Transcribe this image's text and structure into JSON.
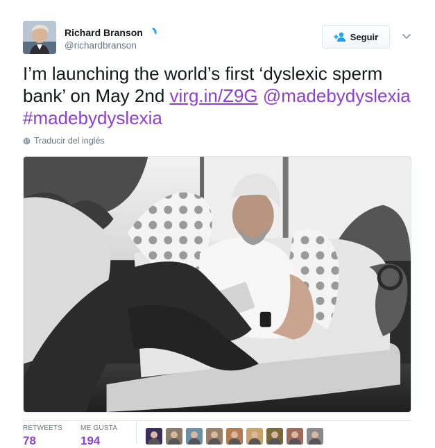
{
  "author": {
    "name": "Richard Branson",
    "handle": "@richardbranson",
    "verified": true
  },
  "follow_button": {
    "label": "Seguir",
    "icon": "person-add-icon"
  },
  "more_menu": {
    "icon": "chevron-down-icon"
  },
  "tweet": {
    "text_part1": "I’m launching the world’s first ‘dyslexic sperm bank’ on May 2nd ",
    "link": "virg.in/Z9G",
    "mention": "@madebydyslexia",
    "hashtag": "#madebydyslexia",
    "link_color": "#8c3fd6"
  },
  "translate": {
    "label": "Traducir del inglés",
    "icon": "globe-icon"
  },
  "stats": {
    "retweets_label": "RETWEETS",
    "retweets_value": "78",
    "likes_label": "ME GUSTA",
    "likes_value": "194"
  },
  "likers": [
    {
      "color": "#3a2e5c"
    },
    {
      "color": "#8a7a6a"
    },
    {
      "color": "#6c8fa8"
    },
    {
      "color": "#9b8067"
    },
    {
      "color": "#b47c4f"
    },
    {
      "color": "#c9a36a"
    },
    {
      "color": "#7a6a3a"
    },
    {
      "color": "#a06a5a"
    },
    {
      "color": "#8a8a8a"
    }
  ]
}
